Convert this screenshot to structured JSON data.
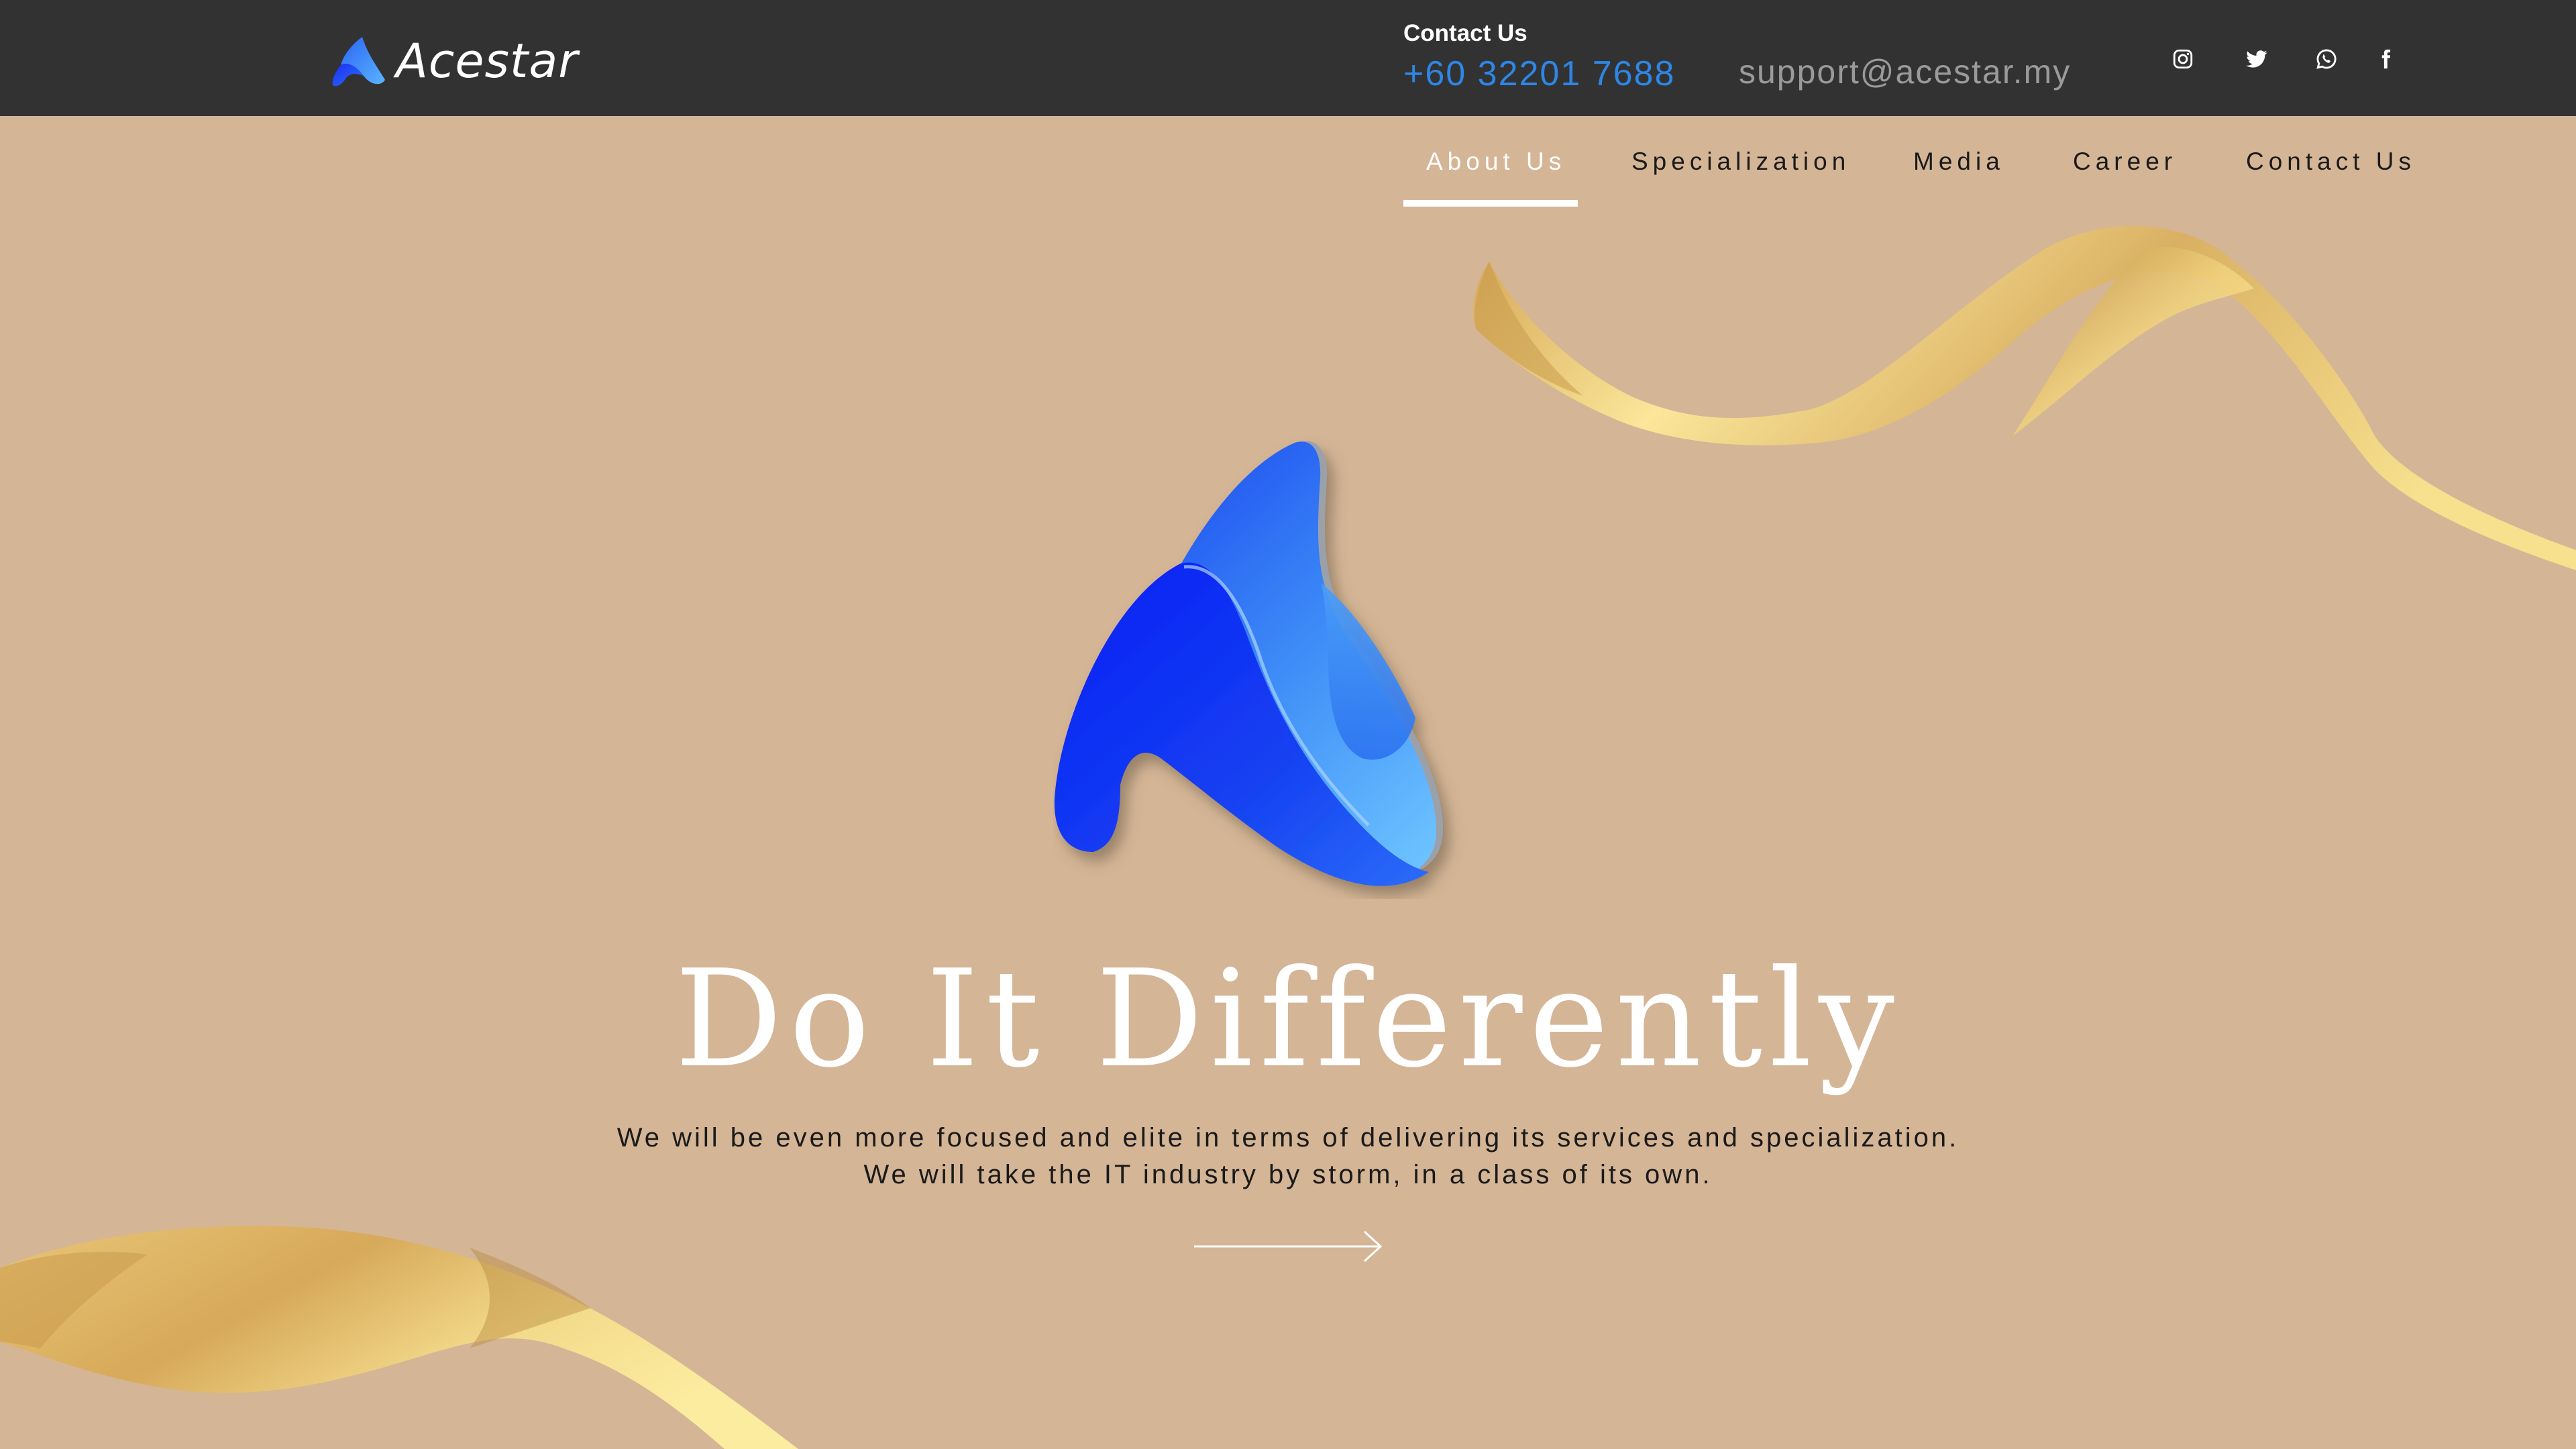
{
  "header": {
    "brand": "Acestar",
    "contact_label": "Contact Us",
    "phone": "+60 32201 7688",
    "email": "support@acestar.my",
    "social": [
      "instagram-icon",
      "twitter-icon",
      "whatsapp-icon",
      "facebook-icon"
    ]
  },
  "nav": {
    "items": [
      {
        "label": "About Us",
        "active": true
      },
      {
        "label": "Specialization",
        "active": false
      },
      {
        "label": "Media",
        "active": false
      },
      {
        "label": "Career",
        "active": false
      },
      {
        "label": "Contact Us",
        "active": false
      }
    ]
  },
  "hero": {
    "headline": "Do It Differently",
    "lines": [
      "We will be even more focused and elite in terms of delivering its services and specialization.",
      "We will take the IT industry by storm, in a class of its own."
    ],
    "cta_icon": "arrow-right-icon"
  },
  "colors": {
    "background": "#d4b596",
    "topbar": "#323232",
    "accent": "#2e86e6",
    "logo_blue": "#1f5af0",
    "ribbon_gold": "#e7c874"
  }
}
